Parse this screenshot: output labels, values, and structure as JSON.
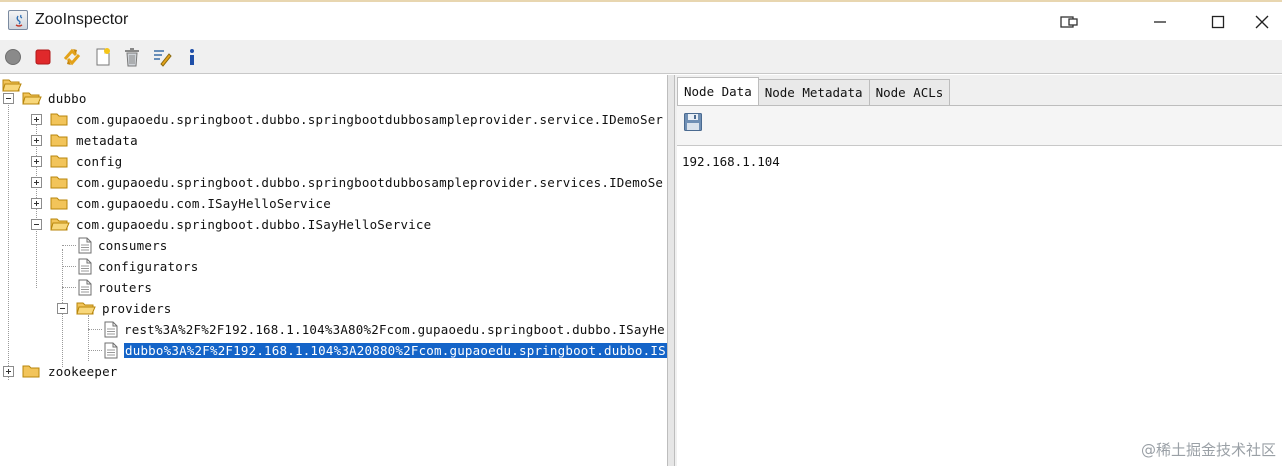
{
  "window": {
    "title": "ZooInspector"
  },
  "toolbar": {
    "buttons": [
      "connect-icon",
      "disconnect-icon",
      "refresh-icon",
      "add-node-icon",
      "delete-node-icon",
      "edit-icon",
      "about-icon"
    ]
  },
  "tree": {
    "root": "",
    "nodes": [
      {
        "label": "dubbo"
      },
      {
        "label": "com.gupaoedu.springboot.dubbo.springbootdubbosampleprovider.service.IDemoSer"
      },
      {
        "label": "metadata"
      },
      {
        "label": "config"
      },
      {
        "label": "com.gupaoedu.springboot.dubbo.springbootdubbosampleprovider.services.IDemoSe"
      },
      {
        "label": "com.gupaoedu.com.ISayHelloService"
      },
      {
        "label": "com.gupaoedu.springboot.dubbo.ISayHelloService"
      },
      {
        "label": "consumers"
      },
      {
        "label": "configurators"
      },
      {
        "label": "routers"
      },
      {
        "label": "providers"
      },
      {
        "label": "rest%3A%2F%2F192.168.1.104%3A80%2Fcom.gupaoedu.springboot.dubbo.ISayHe"
      },
      {
        "label": "dubbo%3A%2F%2F192.168.1.104%3A20880%2Fcom.gupaoedu.springboot.dubbo.IS"
      },
      {
        "label": "zookeeper"
      }
    ]
  },
  "tabs": [
    "Node Data",
    "Node Metadata",
    "Node ACLs"
  ],
  "node_data": {
    "value": "192.168.1.104"
  },
  "watermark": "@稀土掘金技术社区"
}
